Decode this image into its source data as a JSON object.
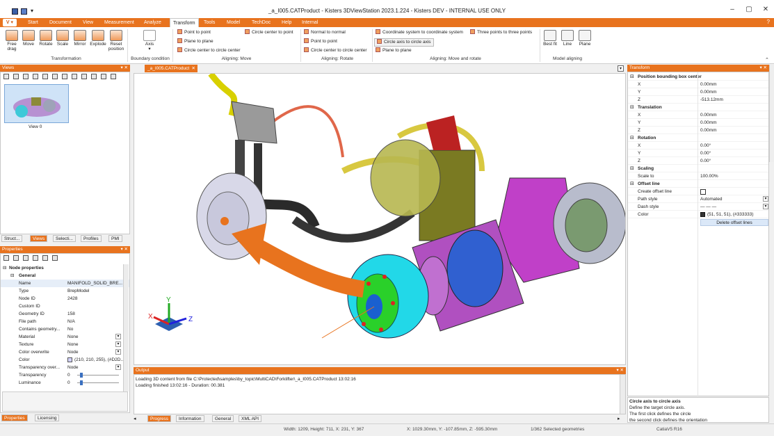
{
  "window": {
    "title": "_a_I005.CATProduct - Kisters 3DViewStation 2023.1.224 - Kisters DEV - INTERNAL USE ONLY"
  },
  "menu": {
    "app_button": "V",
    "tabs": [
      "Start",
      "Document",
      "View",
      "Measurement",
      "Analyze",
      "Transform",
      "Tools",
      "Model",
      "TechDoc",
      "Help",
      "Internal"
    ],
    "active_tab": "Transform"
  },
  "ribbon": {
    "transformation": {
      "label": "Transformation",
      "buttons": [
        "Free drag",
        "Move",
        "Rotate",
        "Scale",
        "Mirror",
        "Explode",
        "Reset position"
      ]
    },
    "boundary": {
      "label": "Boundary condition",
      "button": "Axis"
    },
    "aligning_move": {
      "label": "Aligning: Move",
      "items": [
        "Point to point",
        "Plane to plane",
        "Circle center to circle center",
        "Circle center to point"
      ]
    },
    "aligning_rotate": {
      "label": "Aligning: Rotate",
      "items": [
        "Normal to normal",
        "Point to point",
        "Circle center to circle center"
      ]
    },
    "aligning_move_rotate": {
      "label": "Aligning: Move and rotate",
      "items": [
        "Coordinate system to coordinate system",
        "Circle axis to circle axis",
        "Plane to plane",
        "Three points to three points"
      ]
    },
    "model_aligning": {
      "label": "Model aligning",
      "buttons": [
        "Best fit",
        "Line",
        "Plane"
      ]
    }
  },
  "views_panel": {
    "title": "Views",
    "thumbnail_label": "View 0",
    "tabs": [
      "Struct...",
      "Views",
      "Selecti...",
      "Profiles",
      "PMI"
    ],
    "active_tab": "Views"
  },
  "properties_panel": {
    "title": "Properties",
    "section": "Node properties",
    "group": "General",
    "rows": [
      {
        "k": "Name",
        "v": "MANIFOLD_SOLID_BRE..."
      },
      {
        "k": "Type",
        "v": "BrepModel"
      },
      {
        "k": "Node ID",
        "v": "2428"
      },
      {
        "k": "Custom ID",
        "v": ""
      },
      {
        "k": "Geometry ID",
        "v": "158"
      },
      {
        "k": "File path",
        "v": "N/A"
      },
      {
        "k": "Contains geometry...",
        "v": "No"
      },
      {
        "k": "Material",
        "v": "None"
      },
      {
        "k": "Texture",
        "v": "None"
      },
      {
        "k": "Color overwrite",
        "v": "Node"
      },
      {
        "k": "Color",
        "v": "(210, 210, 255), (#D2D..."
      },
      {
        "k": "Transparency over...",
        "v": "Node"
      },
      {
        "k": "Transparency",
        "v": "0"
      },
      {
        "k": "Luminance",
        "v": "0"
      }
    ],
    "bottom_tabs": [
      "Properties",
      "Licensing"
    ]
  },
  "document": {
    "tab": "_a_I005.CATProduct"
  },
  "axis_labels": {
    "x": "X",
    "y": "Y",
    "z": "Z"
  },
  "output": {
    "title": "Output",
    "lines": [
      "Loading 3D content from file C:\\Protected\\samples\\by_topic\\MultiCAD\\Forklifter\\_a_I005.CATProduct 13:02:16",
      "Loading finished 13:02:16 - Duration: 00.381"
    ],
    "tabs": [
      "Progress",
      "Information",
      "General",
      "XML API"
    ],
    "active_tab": "Progress"
  },
  "transform_panel": {
    "title": "Transform",
    "sections": [
      {
        "name": "Position bounding box center",
        "rows": [
          {
            "k": "X",
            "v": "0.00mm"
          },
          {
            "k": "Y",
            "v": "0.00mm"
          },
          {
            "k": "Z",
            "v": "-513.12mm"
          }
        ]
      },
      {
        "name": "Translation",
        "rows": [
          {
            "k": "X",
            "v": "0.00mm"
          },
          {
            "k": "Y",
            "v": "0.00mm"
          },
          {
            "k": "Z",
            "v": "0.00mm"
          }
        ]
      },
      {
        "name": "Rotation",
        "rows": [
          {
            "k": "X",
            "v": "0.00°"
          },
          {
            "k": "Y",
            "v": "0.00°"
          },
          {
            "k": "Z",
            "v": "0.00°"
          }
        ]
      },
      {
        "name": "Scaling",
        "rows": [
          {
            "k": "Scale to",
            "v": "100.00%"
          }
        ]
      },
      {
        "name": "Offset line",
        "rows": [
          {
            "k": "Create offset line",
            "v": ""
          },
          {
            "k": "Path style",
            "v": "Automated"
          },
          {
            "k": "Dash style",
            "v": "— — —"
          },
          {
            "k": "Color",
            "v": "(51, 51, 51), (#333333)"
          }
        ]
      }
    ],
    "delete_button": "Delete offset lines",
    "help_title": "Circle axis to circle axis",
    "help_lines": [
      "Define the target circle axis.",
      "The first click defines the circle",
      "the second click defines the orientation"
    ]
  },
  "status": {
    "dims": "Width: 1209, Height: 711, X: 231, Y: 367",
    "coords": "X: 1029.30mm, Y: -107.85mm, Z: -595.30mm",
    "selection": "1/362 Selected geometries",
    "format": "CatiaV5 R16"
  }
}
